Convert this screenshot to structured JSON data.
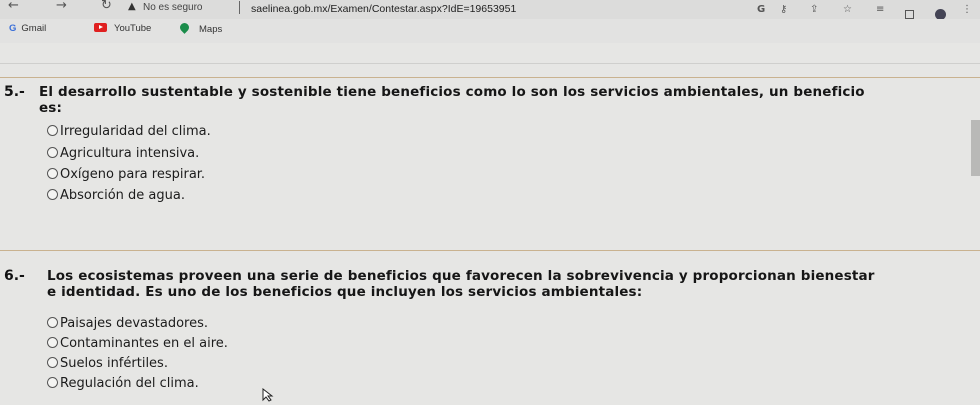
{
  "browser": {
    "security_label": "No es seguro",
    "url": "saelinea.gob.mx/Examen/Contestar.aspx?IdE=19653951",
    "bookmarks": [
      {
        "label": "Gmail",
        "icon": "gmail-icon"
      },
      {
        "label": "YouTube",
        "icon": "youtube-icon"
      },
      {
        "label": "Maps",
        "icon": "maps-icon"
      }
    ]
  },
  "questions": [
    {
      "number": "5.-",
      "text_line1": "El desarrollo sustentable y sostenible tiene beneficios como lo son los servicios ambientales, un beneficio",
      "text_line2": "es:",
      "options": [
        "Irregularidad del clima.",
        "Agricultura intensiva.",
        "Oxígeno para respirar.",
        "Absorción de agua."
      ]
    },
    {
      "number": "6.-",
      "text_line1": "Los ecosistemas proveen una serie de beneficios que favorecen la sobrevivencia y proporcionan bienestar",
      "text_line2": "e identidad. Es uno de los beneficios que incluyen los servicios ambientales:",
      "options": [
        "Paisajes devastadores.",
        "Contaminantes en el aire.",
        "Suelos infértiles.",
        "Regulación del clima."
      ]
    }
  ]
}
